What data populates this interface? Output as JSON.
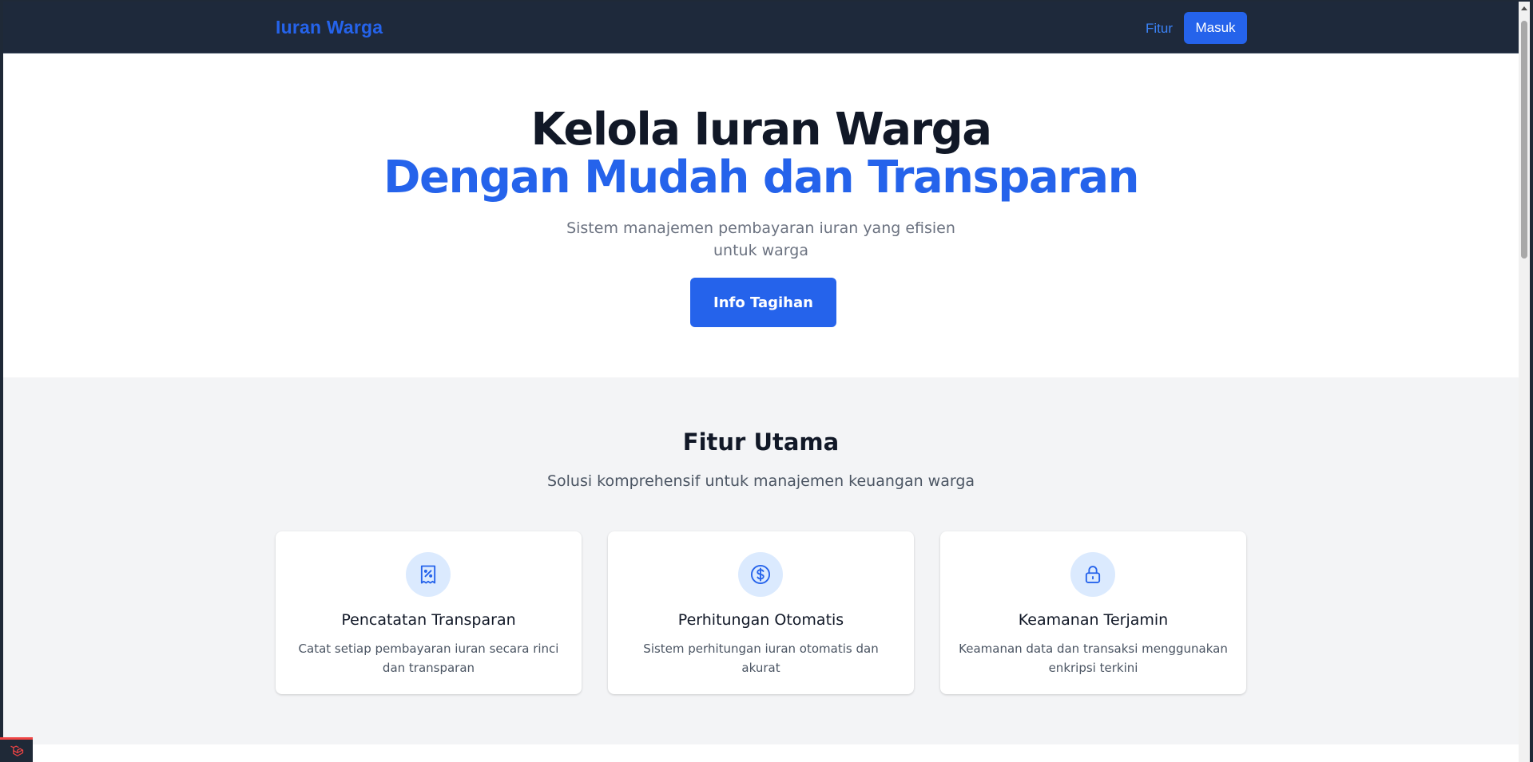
{
  "navbar": {
    "brand": "Iuran Warga",
    "link_fitur": "Fitur",
    "login_label": "Masuk"
  },
  "hero": {
    "title_line1": "Kelola Iuran Warga",
    "title_line2": "Dengan Mudah dan Transparan",
    "subtitle_line1": "Sistem manajemen pembayaran iuran yang efisien",
    "subtitle_line2": "untuk warga",
    "cta_label": "Info Tagihan"
  },
  "features": {
    "title": "Fitur Utama",
    "subtitle": "Solusi komprehensif untuk manajemen keuangan warga",
    "cards": [
      {
        "icon": "receipt-percent-icon",
        "title": "Pencatatan Transparan",
        "description": "Catat setiap pembayaran iuran secara rinci dan transparan"
      },
      {
        "icon": "currency-dollar-icon",
        "title": "Perhitungan Otomatis",
        "description": "Sistem perhitungan iuran otomatis dan akurat"
      },
      {
        "icon": "lock-icon",
        "title": "Keamanan Terjamin",
        "description": "Keamanan data dan transaksi menggunakan enkripsi terkini"
      }
    ]
  },
  "colors": {
    "primary": "#2563eb",
    "navbar_bg": "#1e293b",
    "feature_bg": "#f3f4f6",
    "icon_bg": "#dbeafe",
    "heading": "#111827"
  }
}
